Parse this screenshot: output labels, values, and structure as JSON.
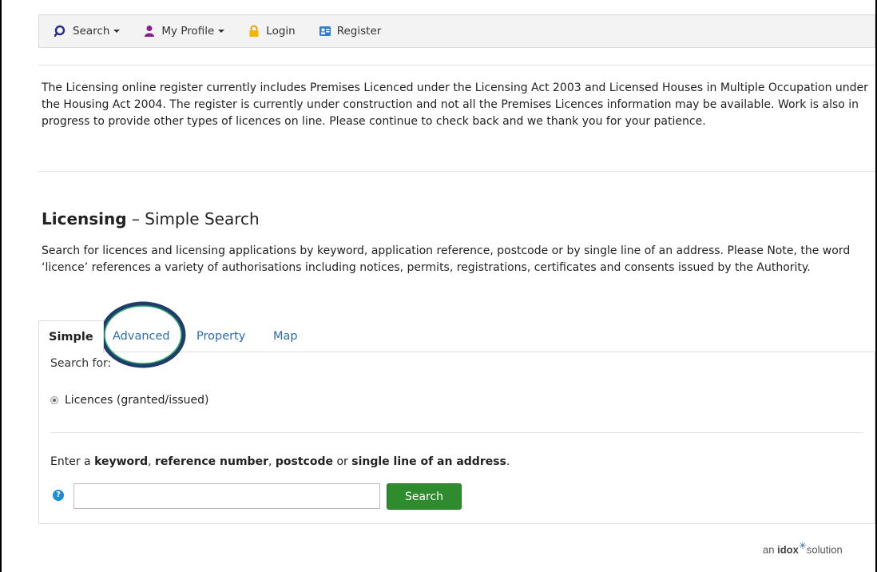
{
  "nav": {
    "items": [
      {
        "label": "Search",
        "icon": "search-icon",
        "dropdown": true
      },
      {
        "label": "My Profile",
        "icon": "user-icon",
        "dropdown": true
      },
      {
        "label": "Login",
        "icon": "lock-icon",
        "dropdown": false
      },
      {
        "label": "Register",
        "icon": "register-icon",
        "dropdown": false
      }
    ]
  },
  "notice": {
    "text": "The Licensing online register currently includes Premises Licenced under the Licensing Act 2003 and Licensed Houses in Multiple Occupation under the Housing Act 2004. The register is currently under construction and not all the Premises Licences information may be available. Work is also in progress to provide other types of licences on line. Please continue to check back and we thank you for your patience."
  },
  "page": {
    "title_strong": "Licensing",
    "title_dash": " – ",
    "title_rest": "Simple Search",
    "description": "Search for licences and licensing applications by keyword, application reference, postcode or by single line of an address. Please Note, the word ‘licence’ references a variety of authorisations including notices, permits, registrations, certificates and consents issued by the Authority."
  },
  "tabs": [
    {
      "label": "Simple",
      "active": true
    },
    {
      "label": "Advanced",
      "active": false
    },
    {
      "label": "Property",
      "active": false
    },
    {
      "label": "Map",
      "active": false
    }
  ],
  "form": {
    "search_for_label": "Search for:",
    "radio_label": "Licences (granted/issued)",
    "enter_prefix": "Enter a ",
    "kw1": "keyword",
    "sep1": ", ",
    "kw2": "reference number",
    "sep2": ", ",
    "kw3": "postcode",
    "sep3": " or ",
    "kw4": "single line of an address",
    "enter_suffix": ".",
    "help_glyph": "?",
    "input_value": "",
    "search_button": "Search"
  },
  "footer": {
    "prefix": "an ",
    "brand": "idox",
    "suffix": "solution"
  },
  "colors": {
    "link": "#2b6cb0",
    "search_button": "#2e8b2e",
    "annotation_circle": "#1f3d6b"
  }
}
